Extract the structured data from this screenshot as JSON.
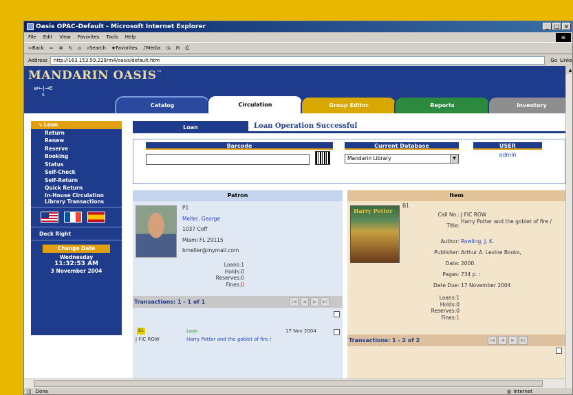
{
  "window": {
    "title": "Oasis OPAC-Default - Microsoft Internet Explorer"
  },
  "menu": [
    "File",
    "Edit",
    "View",
    "Favorites",
    "Tools",
    "Help"
  ],
  "toolbar": {
    "back": "⇦Back",
    "search": "Search",
    "favorites": "Favorites",
    "media": "Media"
  },
  "address": {
    "label": "Address",
    "url": "http://163.153.59.229/m4/oasis/default.htm",
    "go": "Go",
    "links": "Links"
  },
  "brand": {
    "name": "MANDARIN OASIS",
    "tm": "™",
    "compass_n": "w←|→E",
    "compass_s": "s"
  },
  "tabs": [
    "Catalog",
    "Circulation",
    "Group Editor",
    "Reports",
    "Inventory"
  ],
  "nav": {
    "items": [
      "Loan",
      "Return",
      "Renew",
      "Reserve",
      "Booking",
      "Status",
      "Self-Check",
      "Self-Return",
      "Quick Return",
      "In-House Circulation",
      "Library Transactions"
    ],
    "dock": "Dock Right"
  },
  "date": {
    "button": "Change Date",
    "weekday": "Wednesday",
    "time": "11:32:53 AM",
    "date": "3 November 2004"
  },
  "loan": {
    "tab": "Loan",
    "message": "Loan Operation Successful"
  },
  "form": {
    "barcode_label": "Barcode",
    "db_label": "Current Database",
    "db_value": "Mandarin Library",
    "user_label": "USER",
    "user_value": "admin"
  },
  "patron": {
    "header": "Patron",
    "id": "P1",
    "name": "Meller, George",
    "address1": "1037 Coff",
    "address2": "Miami FL 29115",
    "email": "bmeller@mymail.com",
    "loans": "Loans:1",
    "holds": "Holds:0",
    "reserves": "Reserves:0",
    "fines_label": "Fines:",
    "fines_value": "0",
    "transactions": "Transactions: 1 - 1 of 1",
    "row": {
      "badge": "B1",
      "type": "Loan",
      "date": "17 Nov 2004",
      "call": "J FIC ROW",
      "title": "Harry Potter and the goblet of fire /"
    }
  },
  "item": {
    "header": "Item",
    "id": "B1",
    "cover_text": "Harry Potter",
    "fields": [
      {
        "label": "Call No.:",
        "value": "J FIC ROW"
      },
      {
        "label": "Title:",
        "value": "Harry Potter and the goblet of fire /"
      },
      {
        "label": "Author:",
        "value": "Rowling, J. K."
      },
      {
        "label": "Publisher:",
        "value": "Arthur A. Levine Books,"
      },
      {
        "label": "Date:",
        "value": "2000."
      },
      {
        "label": "Pages:",
        "value": "734 p. :"
      },
      {
        "label": "Date Due:",
        "value": "17 November 2004"
      }
    ],
    "loans": "Loans:1",
    "holds": "Holds:0",
    "reserves": "Reserves:0",
    "fines_label": "Fines:",
    "fines_value": "1",
    "transactions": "Transactions: 1 - 2 of 2"
  },
  "status": {
    "left": "Done",
    "zone": "Internet"
  },
  "colors": {
    "navy": "#1f3b8c",
    "gold": "#e0a010",
    "link": "#2244bb",
    "red": "#dd2222"
  }
}
